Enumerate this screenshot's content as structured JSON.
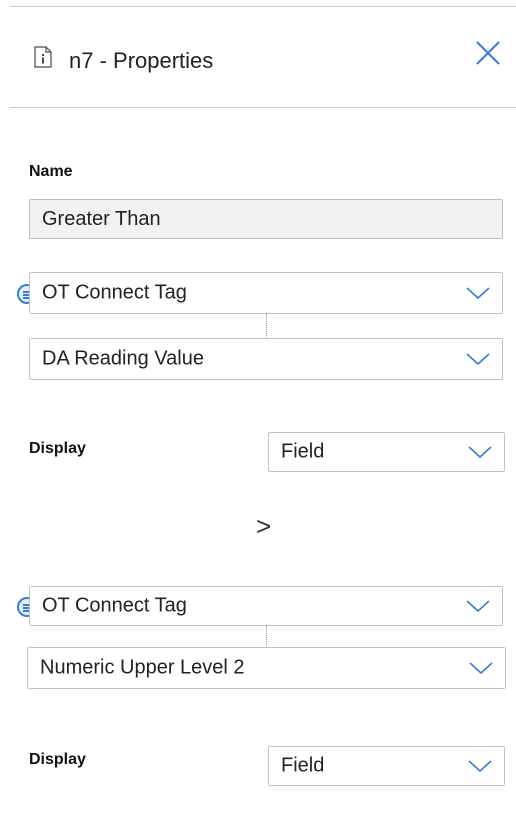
{
  "header": {
    "title": "n7 - Properties"
  },
  "name_section": {
    "label": "Name",
    "value": "Greater Than"
  },
  "left_operand": {
    "source": "OT Connect Tag",
    "field": "DA Reading Value",
    "display_label": "Display",
    "display_value": "Field"
  },
  "operator": ">",
  "right_operand": {
    "source": "OT Connect Tag",
    "field": "Numeric Upper Level 2",
    "display_label": "Display",
    "display_value": "Field"
  },
  "colors": {
    "close_icon": "#3a7bd5",
    "list_icon": "#3a7bd5",
    "border": "#c3c3c3"
  }
}
